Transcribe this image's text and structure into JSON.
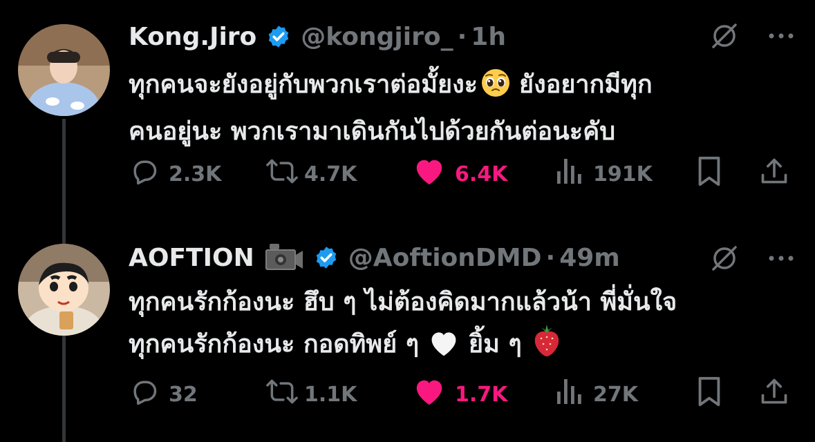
{
  "tweets": [
    {
      "name": "Kong.Jiro",
      "handle": "@kongjiro_",
      "dot": "·",
      "time": "1h",
      "text_line1": "ทุกคนจะยังอยู่กับพวกเราต่อมั้ยงะ",
      "text_line1_rest": "ยังอยากมีทุก",
      "text_line2": "คนอยู่นะ พวกเรามาเดินกันไปด้วยกันต่อนะคับ",
      "replies": "2.3K",
      "reposts": "4.7K",
      "likes": "6.4K",
      "views": "191K"
    },
    {
      "name": "AOFTION",
      "handle": "@AoftionDMD",
      "dot": "·",
      "time": "49m",
      "text_line1": "ทุกคนรักก้องนะ ฮึบ ๆ ไม่ต้องคิดมากแล้วน้า พี่มั่นใจ",
      "text_line2": "ทุกคนรักก้องนะ กอดทิพย์ ๆ",
      "text_line2_mid": "ยิ้ม ๆ",
      "replies": "32",
      "reposts": "1.1K",
      "likes": "1.7K",
      "views": "27K"
    }
  ],
  "colors": {
    "background": "#000000",
    "text": "#e7e9ea",
    "muted": "#71767b",
    "like": "#f91880",
    "verified": "#1d9bf0",
    "thread_line": "#333639"
  },
  "icons": [
    "verified-badge-icon",
    "camera-icon",
    "grok-icon",
    "more-icon",
    "reply-icon",
    "repost-icon",
    "like-icon",
    "views-icon",
    "bookmark-icon",
    "share-icon",
    "pleading-face-emoji",
    "white-heart-emoji",
    "strawberry-emoji"
  ]
}
